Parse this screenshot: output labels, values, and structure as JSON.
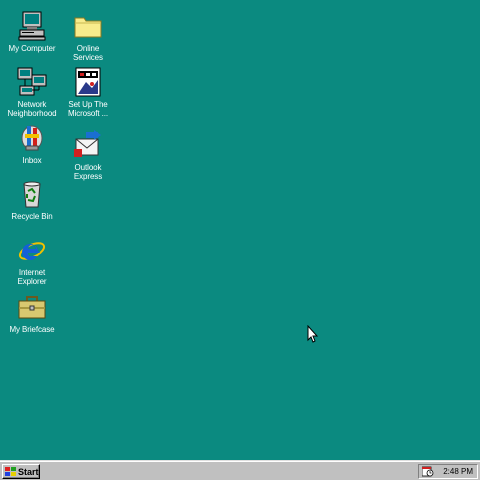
{
  "desktop": {
    "background_color": "#0b8a80",
    "icons": [
      {
        "id": "my-computer",
        "label": "My Computer",
        "icon": "computer-icon"
      },
      {
        "id": "network",
        "label": "Network\nNeighborhood",
        "icon": "network-icon"
      },
      {
        "id": "inbox",
        "label": "Inbox",
        "icon": "inbox-icon"
      },
      {
        "id": "recycle",
        "label": "Recycle Bin",
        "icon": "recycle-bin-icon"
      },
      {
        "id": "ie",
        "label": "Internet\nExplorer",
        "icon": "internet-explorer-icon"
      },
      {
        "id": "briefcase",
        "label": "My Briefcase",
        "icon": "briefcase-icon"
      },
      {
        "id": "online",
        "label": "Online\nServices",
        "icon": "folder-icon"
      },
      {
        "id": "msn",
        "label": "Set Up The\nMicrosoft ...",
        "icon": "msn-icon"
      },
      {
        "id": "outlook",
        "label": "Outlook\nExpress",
        "icon": "outlook-express-icon"
      }
    ]
  },
  "taskbar": {
    "start_label": "Start",
    "clock": "2:48 PM"
  }
}
